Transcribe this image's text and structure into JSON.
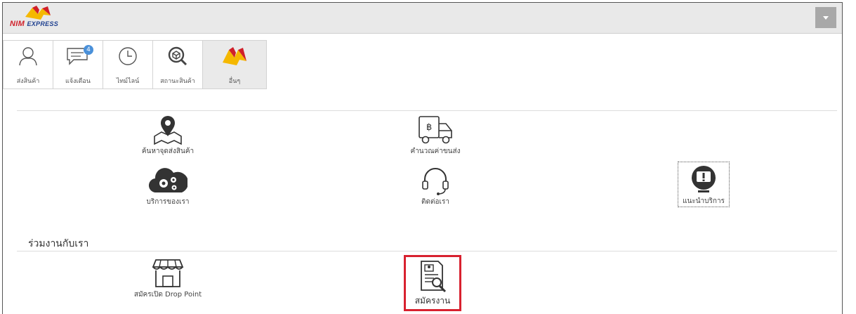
{
  "app": {
    "logo_brand": "NIM",
    "logo_sub": "EXPRESS"
  },
  "tabs": [
    {
      "label": "ส่งสินค้า",
      "icon": "user-icon"
    },
    {
      "label": "แจ้งเตือน",
      "icon": "chat-icon",
      "badge": "4"
    },
    {
      "label": "ไทม์ไลน์",
      "icon": "clock-icon"
    },
    {
      "label": "สถานะสินค้า",
      "icon": "box-search-icon"
    },
    {
      "label": "อื่นๆ",
      "icon": "nim-logo-icon",
      "active": true
    }
  ],
  "services": [
    {
      "label": "ค้นหาจุดส่งสินค้า",
      "icon": "map-pin-icon"
    },
    {
      "label": "คำนวณค่าขนส่ง",
      "icon": "truck-baht-icon"
    },
    {
      "label": "บริการของเรา",
      "icon": "cloud-gears-icon"
    },
    {
      "label": "ติดต่อเรา",
      "icon": "headset-icon"
    },
    {
      "label": "แนะนำบริการ",
      "icon": "info-board-icon"
    }
  ],
  "join_section": {
    "title": "ร่วมงานกับเรา",
    "items": [
      {
        "label": "สมัครเปิด Drop Point",
        "icon": "shop-icon"
      },
      {
        "label": "สมัครงาน",
        "icon": "resume-search-icon",
        "highlighted": true
      }
    ]
  },
  "colors": {
    "highlight": "#d8212f",
    "badge": "#4a90d9",
    "logo_red": "#d0202a",
    "logo_blue": "#1d3f8f",
    "logo_yellow": "#f5b800"
  }
}
